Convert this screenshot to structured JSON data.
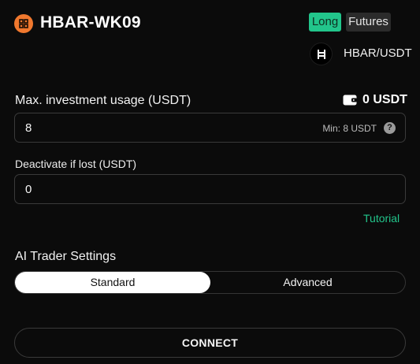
{
  "header": {
    "bot_name": "HBAR-WK09",
    "bot_icon": "grid-bot-icon",
    "accent_color": "#f0782e",
    "direction_badge": "Long",
    "market_badge": "Futures",
    "pair_icon": "hedera-logo-icon",
    "pair": "HBAR/USDT"
  },
  "investment": {
    "label": "Max. investment usage (USDT)",
    "balance": "0 USDT",
    "wallet_icon": "wallet-icon",
    "value": "8",
    "min_hint": "Min: 8 USDT",
    "help_icon": "question-icon"
  },
  "deactivate": {
    "label": "Deactivate if lost (USDT)",
    "value": "0"
  },
  "tutorial_link": "Tutorial",
  "ai_settings": {
    "label": "AI Trader Settings",
    "options": [
      "Standard",
      "Advanced"
    ],
    "selected": "Standard"
  },
  "connect_label": "CONNECT",
  "colors": {
    "green": "#22c58b",
    "background": "#0b0b0b"
  }
}
